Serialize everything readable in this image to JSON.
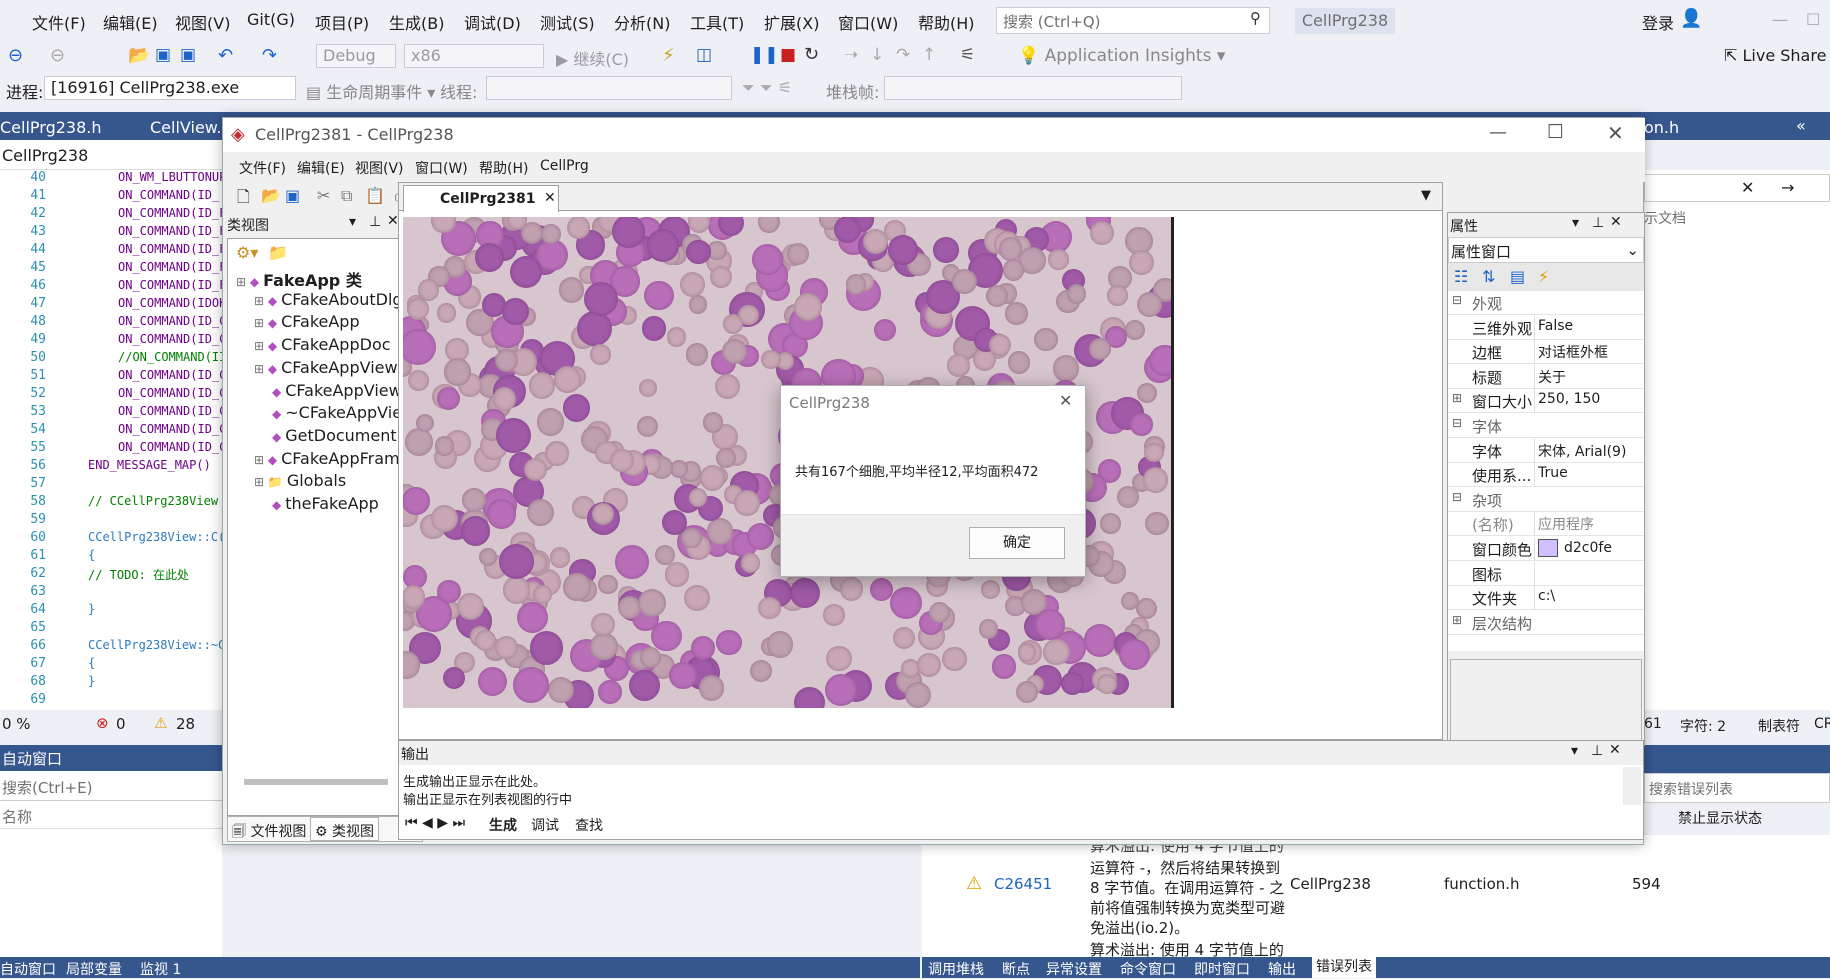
{
  "menu": {
    "file": "文件(F)",
    "edit": "编辑(E)",
    "view": "视图(V)",
    "git": "Git(G)",
    "project": "项目(P)",
    "build": "生成(B)",
    "debug": "调试(D)",
    "test": "测试(S)",
    "analyze": "分析(N)",
    "tools": "工具(T)",
    "ext": "扩展(X)",
    "window": "窗口(W)",
    "help": "帮助(H)"
  },
  "search_placeholder": "搜索 (Ctrl+Q)",
  "solution_badge": "CellPrg238",
  "login": "登录",
  "toolbar": {
    "config": "Debug",
    "platform": "x86",
    "continue": "继续(C)",
    "insights": "Application Insights",
    "liveshare": "Live Share"
  },
  "process": {
    "label": "进程:",
    "value": "[16916] CellPrg238.exe",
    "lifecycle": "生命周期事件",
    "thread": "线程:",
    "stack": "堆栈帧:"
  },
  "editor_tabs": [
    "CellPrg238.h",
    "CellView.c",
    "on.h"
  ],
  "scope": "CellPrg238",
  "code_lines": [
    {
      "n": "40",
      "t": "ON_WM_LBUTTONUP"
    },
    {
      "n": "41",
      "t": "ON_COMMAND(ID_"
    },
    {
      "n": "42",
      "t": "ON_COMMAND(ID_F"
    },
    {
      "n": "43",
      "t": "ON_COMMAND(ID_F"
    },
    {
      "n": "44",
      "t": "ON_COMMAND(ID_F"
    },
    {
      "n": "45",
      "t": "ON_COMMAND(ID_F"
    },
    {
      "n": "46",
      "t": "ON_COMMAND(ID_F"
    },
    {
      "n": "47",
      "t": "ON_COMMAND(IDOK"
    },
    {
      "n": "48",
      "t": "ON_COMMAND(ID_C"
    },
    {
      "n": "49",
      "t": "ON_COMMAND(ID_C"
    },
    {
      "n": "50",
      "t": "//ON_COMMAND(II"
    },
    {
      "n": "51",
      "t": "ON_COMMAND(ID_C"
    },
    {
      "n": "52",
      "t": "ON_COMMAND(ID_C"
    },
    {
      "n": "53",
      "t": "ON_COMMAND(ID_C"
    },
    {
      "n": "54",
      "t": "ON_COMMAND(ID_C"
    },
    {
      "n": "55",
      "t": "ON_COMMAND(ID_C"
    },
    {
      "n": "56",
      "t": "END_MESSAGE_MAP()"
    },
    {
      "n": "57",
      "t": ""
    },
    {
      "n": "58",
      "t": "// CCellPrg238View"
    },
    {
      "n": "59",
      "t": ""
    },
    {
      "n": "60",
      "t": "CCellPrg238View::C("
    },
    {
      "n": "61",
      "t": "{"
    },
    {
      "n": "62",
      "t": "    // TODO: 在此处"
    },
    {
      "n": "63",
      "t": ""
    },
    {
      "n": "64",
      "t": "}"
    },
    {
      "n": "65",
      "t": ""
    },
    {
      "n": "66",
      "t": "CCellPrg238View::~C"
    },
    {
      "n": "67",
      "t": "{"
    },
    {
      "n": "68",
      "t": "}"
    },
    {
      "n": "69",
      "t": ""
    }
  ],
  "status_left": {
    "zoom": "0 %",
    "errors": "0",
    "warnings": "28"
  },
  "status_right": {
    "line": "61",
    "char": "字符: 2",
    "tab": "制表符",
    "crlf": "CR"
  },
  "auto_window": {
    "title": "自动窗口",
    "search": "搜索(Ctrl+E)",
    "col_name": "名称"
  },
  "bottom_left_tabs": [
    "自动窗口",
    "局部变量",
    "监视 1"
  ],
  "bottom_right_tabs": [
    "调用堆栈",
    "断点",
    "异常设置",
    "命令窗口",
    "即时窗口",
    "输出",
    "错误列表"
  ],
  "error_list": {
    "search": "搜索错误列表",
    "suppress": "禁止显示状态",
    "text_top": "算术溢出: 使用 4 字节值上的",
    "code": "C26451",
    "desc": [
      "运算符 -，然后将结果转换到",
      "8 字节值。在调用运算符 - 之",
      "前将值强制转换为宽类型可避",
      "免溢出(io.2)。"
    ],
    "project": "CellPrg238",
    "file": "function.h",
    "line": "594",
    "next": "算术溢出: 使用 4 字节值上的"
  },
  "right_panel": {
    "label": "示文档"
  },
  "app": {
    "title": "CellPrg2381 - CellPrg238",
    "menu": [
      "文件(F)",
      "编辑(E)",
      "视图(V)",
      "窗口(W)",
      "帮助(H)",
      "CellPrg"
    ],
    "classview_title": "类视图",
    "tree": [
      {
        "label": "FakeApp 类",
        "level": 0,
        "bold": true
      },
      {
        "label": "CFakeAboutDlg",
        "level": 1
      },
      {
        "label": "CFakeApp",
        "level": 1
      },
      {
        "label": "CFakeAppDoc",
        "level": 1
      },
      {
        "label": "CFakeAppView",
        "level": 1
      },
      {
        "label": "CFakeAppView",
        "level": 2
      },
      {
        "label": "~CFakeAppVie",
        "level": 2
      },
      {
        "label": "GetDocument(",
        "level": 2
      },
      {
        "label": "CFakeAppFrame",
        "level": 1
      },
      {
        "label": "Globals",
        "level": 1
      },
      {
        "label": "theFakeApp",
        "level": 2
      }
    ],
    "left_tabs": [
      "文件视图",
      "类视图"
    ],
    "doc_tab": "CellPrg2381",
    "props_title": "属性",
    "props_selector": "属性窗口",
    "props": [
      {
        "k": "外观",
        "v": "",
        "cat": true
      },
      {
        "k": "三维外观",
        "v": "False"
      },
      {
        "k": "边框",
        "v": "对话框外框"
      },
      {
        "k": "标题",
        "v": "关于"
      },
      {
        "k": "窗口大小",
        "v": "250, 150",
        "exp": true
      },
      {
        "k": "字体",
        "v": "",
        "cat": true
      },
      {
        "k": "字体",
        "v": "宋体, Arial(9)"
      },
      {
        "k": "使用系...",
        "v": "True"
      },
      {
        "k": "杂项",
        "v": "",
        "cat": true
      },
      {
        "k": "(名称)",
        "v": "应用程序",
        "gray": true
      },
      {
        "k": "窗口颜色",
        "v": "d2c0fe",
        "swatch": "#d2c0fe"
      },
      {
        "k": "图标",
        "v": ""
      },
      {
        "k": "文件夹",
        "v": "c:\\"
      },
      {
        "k": "层次结构",
        "v": "",
        "cat": true,
        "exp": true
      }
    ],
    "output_title": "输出",
    "output_lines": [
      "生成输出正显示在此处。",
      "输出正显示在列表视图的行中"
    ],
    "output_tabs": [
      "生成",
      "调试",
      "查找"
    ]
  },
  "dialog": {
    "title": "CellPrg238",
    "message": "共有167个细胞,平均半径12,平均面积472",
    "ok": "确定"
  }
}
